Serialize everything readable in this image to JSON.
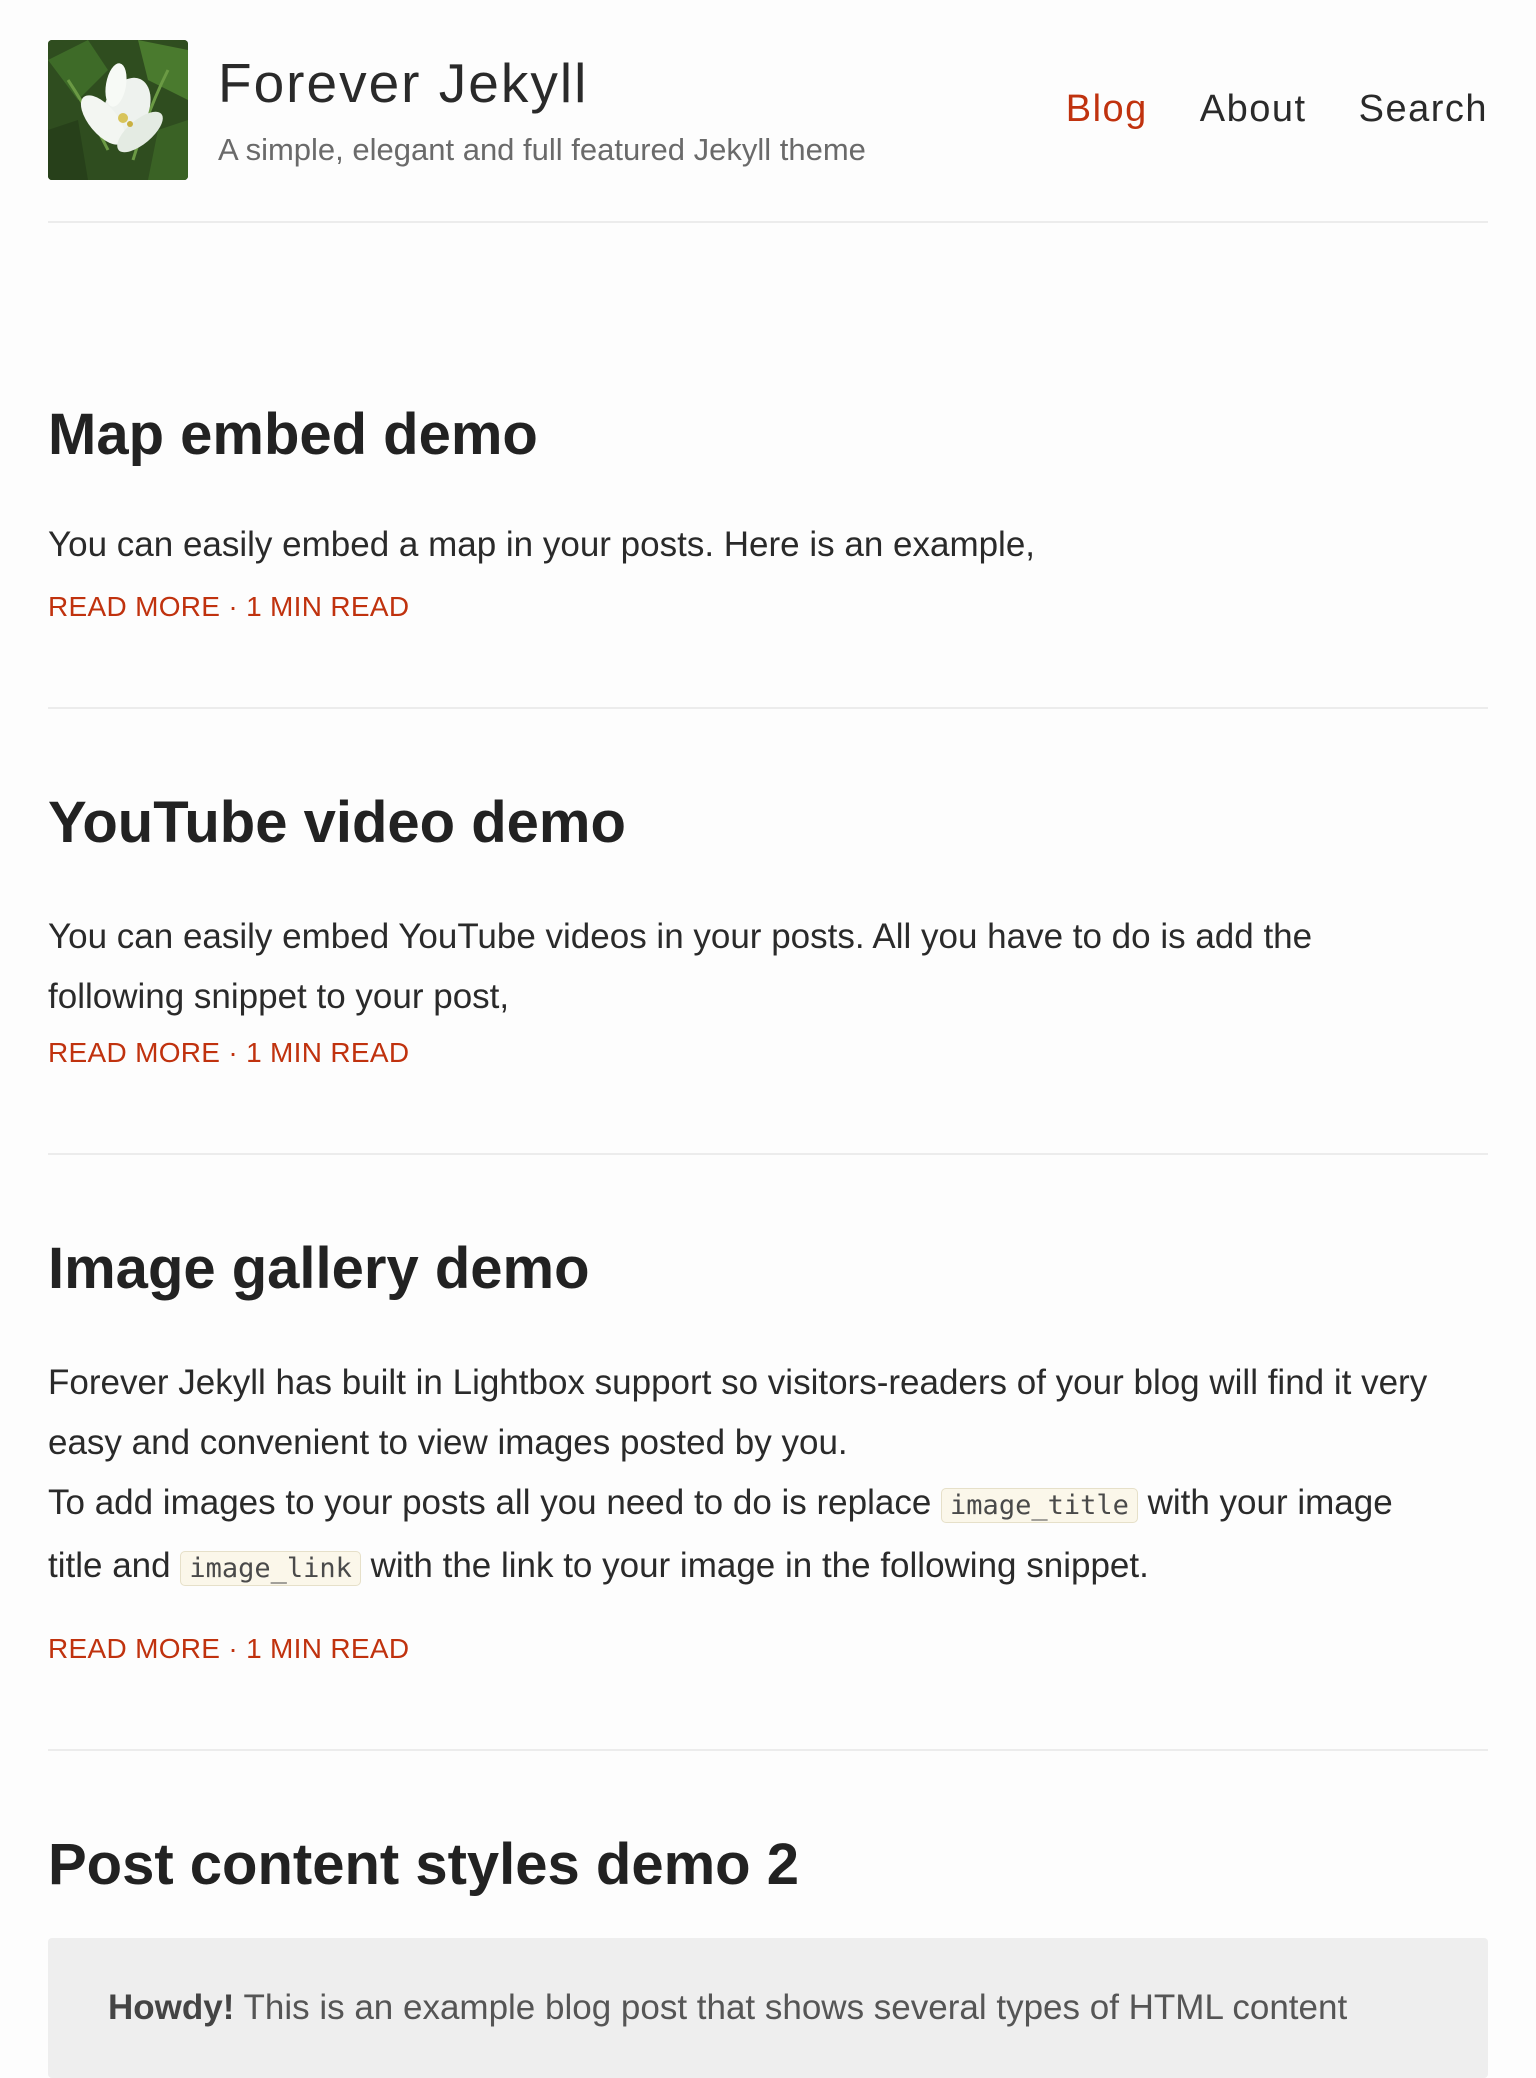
{
  "site": {
    "title": "Forever Jekyll",
    "tagline": "A simple, elegant and full featured Jekyll theme"
  },
  "nav": {
    "items": [
      {
        "label": "Blog",
        "active": true
      },
      {
        "label": "About",
        "active": false
      },
      {
        "label": "Search",
        "active": false
      }
    ]
  },
  "posts": [
    {
      "title": "Map embed demo",
      "excerpt": "You can easily embed a map in your posts. Here is an example,",
      "read_more": "READ MORE",
      "separator": "·",
      "read_time": "1 MIN READ"
    },
    {
      "title": "YouTube video demo",
      "excerpt_line1": "You can easily embed YouTube videos in your posts. All you have to do is add the",
      "excerpt_line2": "following snippet to your post,",
      "read_more": "READ MORE",
      "separator": "·",
      "read_time": "1 MIN READ"
    },
    {
      "title": "Image gallery demo",
      "line1": "Forever Jekyll has built in Lightbox support so visitors-readers of your blog will find it very",
      "line2": "easy and convenient to view images posted by you.",
      "line3_pre": "To add images to your posts all you need to do is replace",
      "code1": "image_title",
      "line3_post": "with your image",
      "line4_pre": "title and",
      "code2": "image_link",
      "line4_post": "with the link to your image in the following snippet.",
      "read_more": "READ MORE",
      "separator": "·",
      "read_time": "1 MIN READ"
    },
    {
      "title": "Post content styles demo 2",
      "callout_bold": "Howdy!",
      "callout_text": "This is an example blog post that shows several types of HTML content"
    }
  ],
  "colors": {
    "accent": "#c0320e",
    "text": "#222222",
    "muted": "#6a6a6a",
    "divider": "#ececec",
    "callout_bg": "#eeeeee"
  }
}
